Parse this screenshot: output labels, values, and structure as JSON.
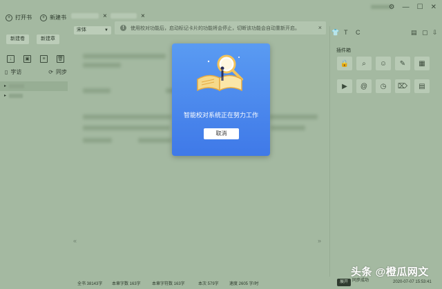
{
  "toolbar": {
    "open_book": "打开书",
    "new_book": "新建书"
  },
  "tabs": {
    "close_glyph": "×"
  },
  "notice": {
    "text": "使用校对功能后，启动标记卡片的功能将会停止，切断该功能会自动重新开启。",
    "close_glyph": "×"
  },
  "sidebar": {
    "new_volume": "新建卷",
    "new_chapter": "新建章",
    "word_count": "字访",
    "sync": "同步"
  },
  "editor": {
    "font_select": "宋体"
  },
  "right_panel": {
    "title": "插件箱"
  },
  "status": {
    "total_words": "全书 38143字",
    "chapter_words": "本章字数 163字",
    "chapter_chars": "本章字符数 163字",
    "session": "本次 579字",
    "speed": "速度 2605 字/时",
    "expand_button": "展开",
    "sync_state": "同步成功",
    "datetime": "2020-07-07 15:53:41"
  },
  "modal": {
    "message": "智能校对系统正在努力工作",
    "cancel_label": "取消"
  },
  "watermark": {
    "text": "头条 @橙瓜网文"
  },
  "colors": {
    "overlay_green": "#a4b9a1",
    "modal_blue_top": "#5a9bf2",
    "modal_blue_bottom": "#3f79e8"
  }
}
